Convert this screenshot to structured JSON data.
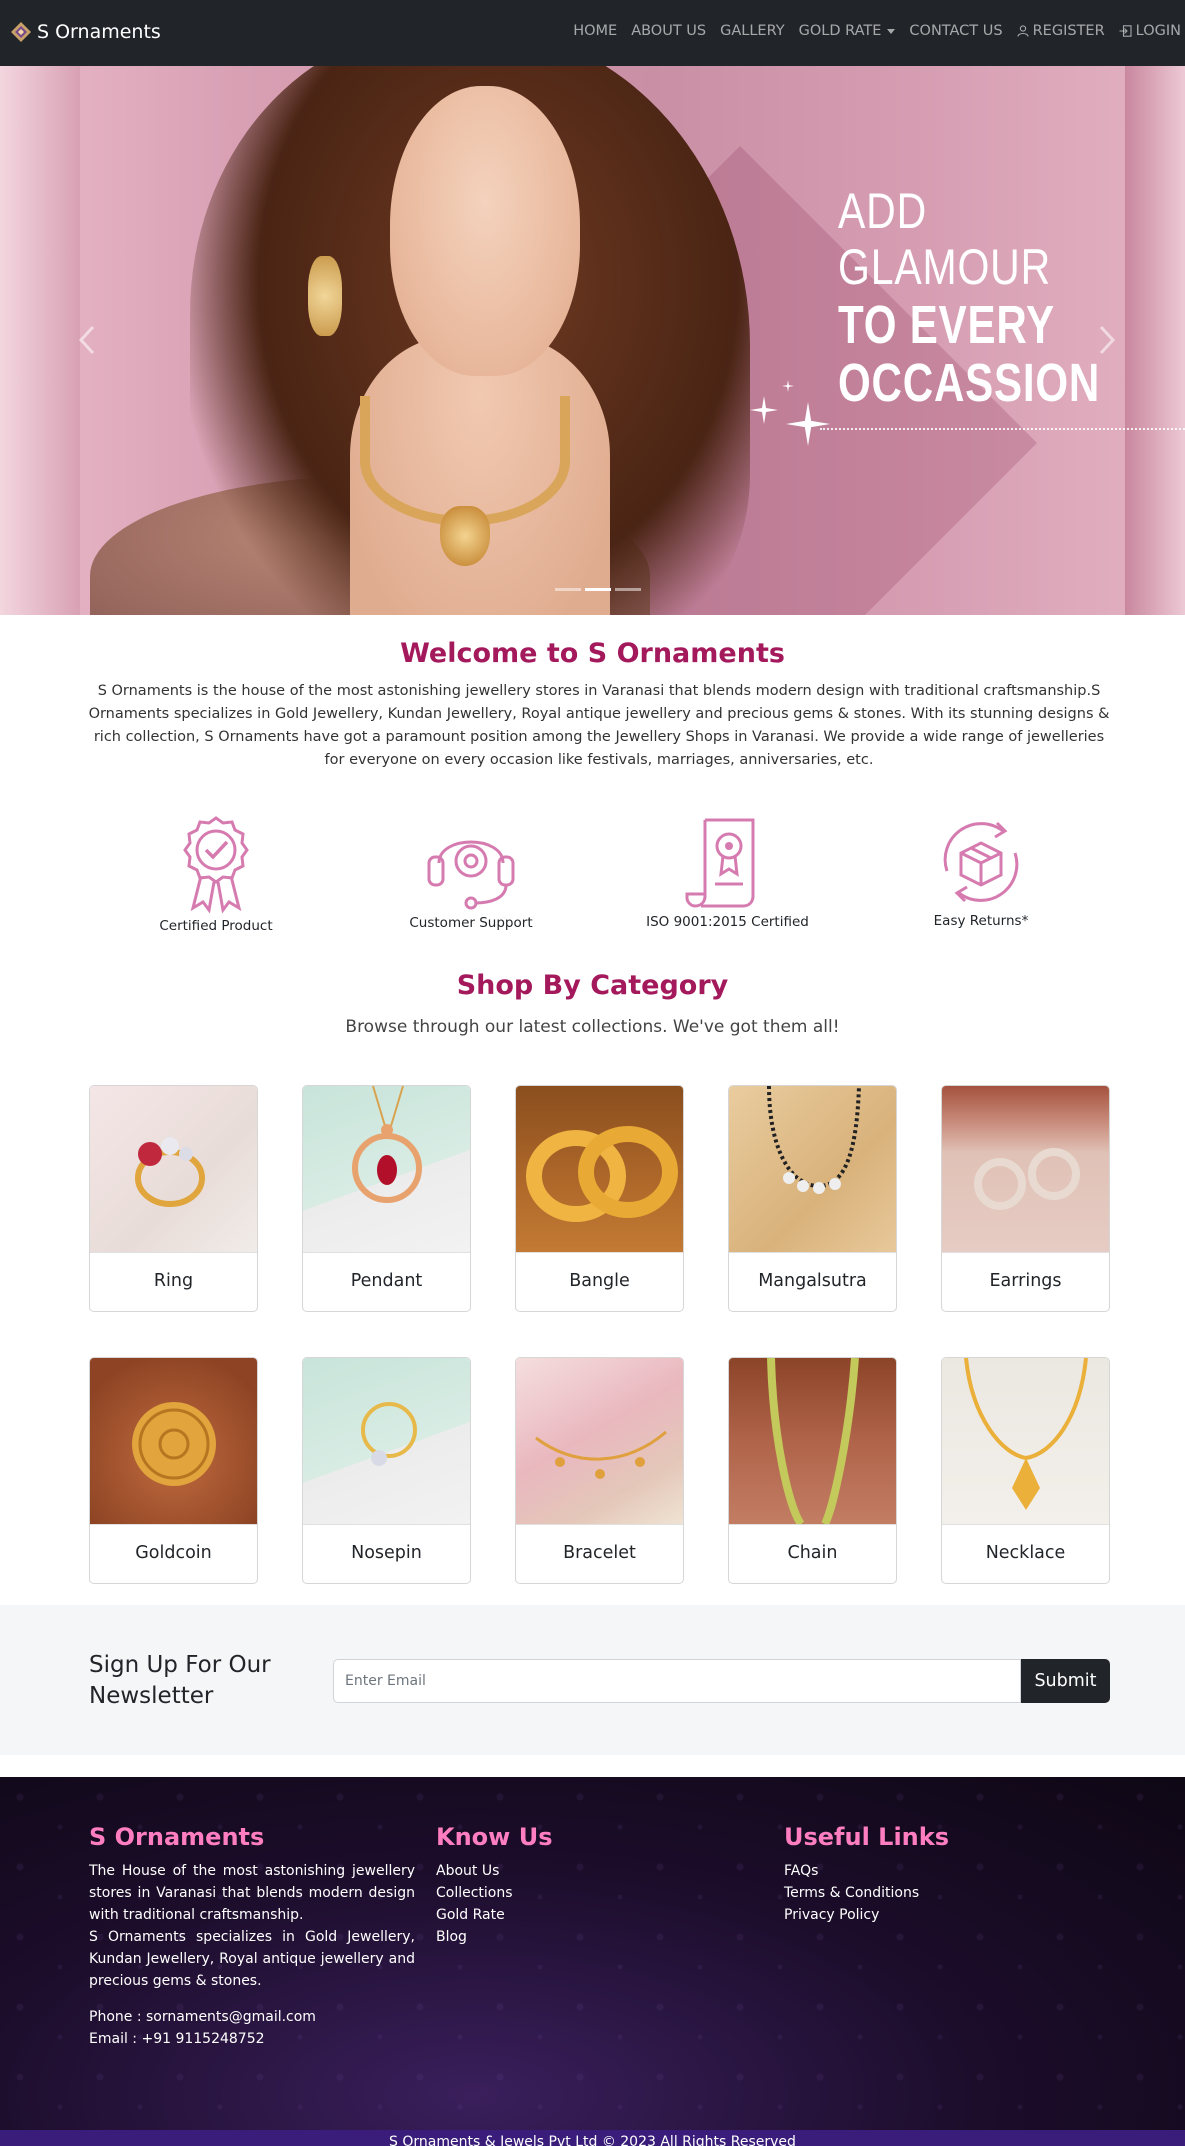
{
  "brand": {
    "name": "S Ornaments"
  },
  "nav": {
    "home": "HOME",
    "about": "ABOUT US",
    "gallery": "GALLERY",
    "gold_rate": "GOLD RATE",
    "contact": "CONTACT US",
    "register": "REGISTER",
    "login": "LOGIN"
  },
  "hero": {
    "line1": "ADD",
    "line2": "GLAMOUR",
    "line3": "TO EVERY",
    "line4": "OCCASSION",
    "prev_icon": "chevron-left-icon",
    "next_icon": "chevron-right-icon",
    "active_slide": 2,
    "slide_count": 3
  },
  "welcome": {
    "title": "Welcome to S Ornaments",
    "text": "S Ornaments is the house of the most astonishing jewellery stores in Varanasi that blends modern design with traditional craftsmanship.S Ornaments specializes in Gold Jewellery, Kundan Jewellery, Royal antique jewellery and precious gems & stones. With its stunning designs & rich collection, S Ornaments have got a paramount position among the Jewellery Shops in Varanasi. We provide a wide range of jewelleries for everyone on every occasion like festivals, marriages, anniversaries, etc."
  },
  "features": [
    {
      "label": "Certified Product",
      "icon": "certified-badge-icon"
    },
    {
      "label": "Customer Support",
      "icon": "headset-icon"
    },
    {
      "label": "ISO 9001:2015 Certified",
      "icon": "certificate-scroll-icon"
    },
    {
      "label": "Easy Returns*",
      "icon": "return-box-icon"
    }
  ],
  "category": {
    "title": "Shop By Category",
    "subtitle": "Browse through our latest collections. We've got them all!",
    "items": [
      {
        "label": "Ring"
      },
      {
        "label": "Pendant"
      },
      {
        "label": "Bangle"
      },
      {
        "label": "Mangalsutra"
      },
      {
        "label": "Earrings"
      },
      {
        "label": "Goldcoin"
      },
      {
        "label": "Nosepin"
      },
      {
        "label": "Bracelet"
      },
      {
        "label": "Chain"
      },
      {
        "label": "Necklace"
      }
    ]
  },
  "newsletter": {
    "title_line1": "Sign Up For Our",
    "title_line2": "Newsletter",
    "placeholder": "Enter Email",
    "button": "Submit"
  },
  "footer": {
    "about": {
      "title": "S Ornaments",
      "p1": "The House of the most astonishing jewellery stores in Varanasi that blends modern design with traditional craftsmanship.",
      "p2": "S Ornaments specializes in Gold Jewellery, Kundan Jewellery, Royal antique jewellery and precious gems & stones.",
      "phone": "Phone : sornaments@gmail.com",
      "email": "Email : +91 9115248752"
    },
    "know_us": {
      "title": "Know Us",
      "links": [
        "About Us",
        "Collections",
        "Gold Rate",
        "Blog"
      ]
    },
    "useful": {
      "title": "Useful Links",
      "links": [
        "FAQs",
        "Terms & Conditions",
        "Privacy Policy"
      ]
    },
    "copyright": "S Ornaments & Jewels Pvt Ltd © 2023 All Rights Reserved"
  },
  "colors": {
    "accent": "#a3195b",
    "footer_heading": "#ff7ec1",
    "navbar": "#212529"
  }
}
